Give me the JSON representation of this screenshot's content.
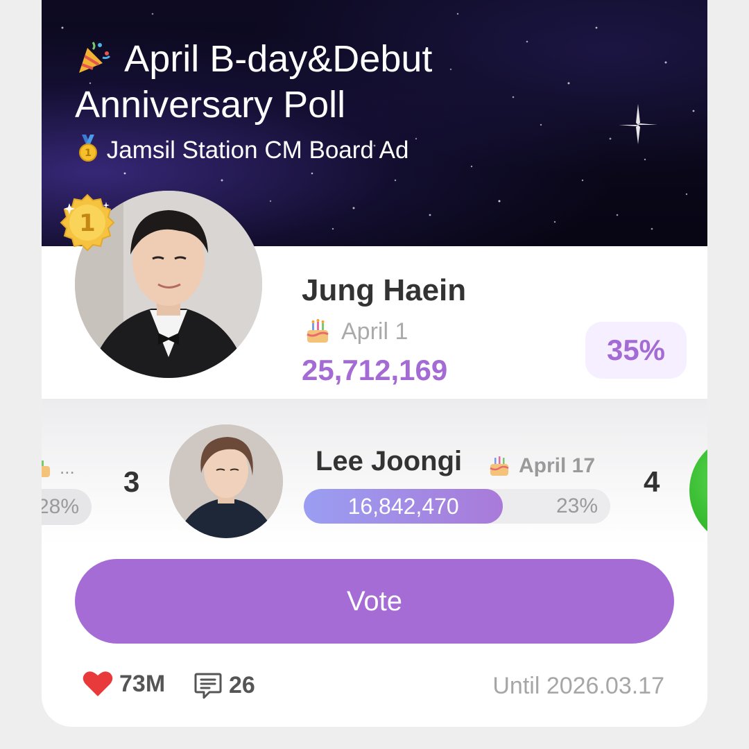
{
  "poll": {
    "title_icon": "party-popper",
    "title": "April B-day&Debut Anniversary Poll",
    "subtitle_icon": "gold-medal",
    "subtitle": "Jamsil Station CM Board Ad"
  },
  "leader": {
    "rank": "1",
    "name": "Jung Haein",
    "birthday": "April 1",
    "votes": "25,712,169",
    "percent": "35%",
    "icon": "birthday-cake"
  },
  "carousel": {
    "left_peek": {
      "ellipsis": "...",
      "percent": "28%"
    },
    "current": {
      "rank": "3",
      "name": "Lee Joongi",
      "birthday": "April 17",
      "votes": "16,842,470",
      "percent": "23%",
      "share": 0.65
    },
    "right_peek": {
      "rank": "4"
    }
  },
  "vote_button": {
    "label": "Vote",
    "color": "#a66cd6"
  },
  "footer": {
    "likes": "73M",
    "comments": "26",
    "until": "Until 2026.03.17"
  },
  "colors": {
    "accent": "#a46bd4",
    "heart": "#e83a3a",
    "banner": "#0b0819"
  }
}
